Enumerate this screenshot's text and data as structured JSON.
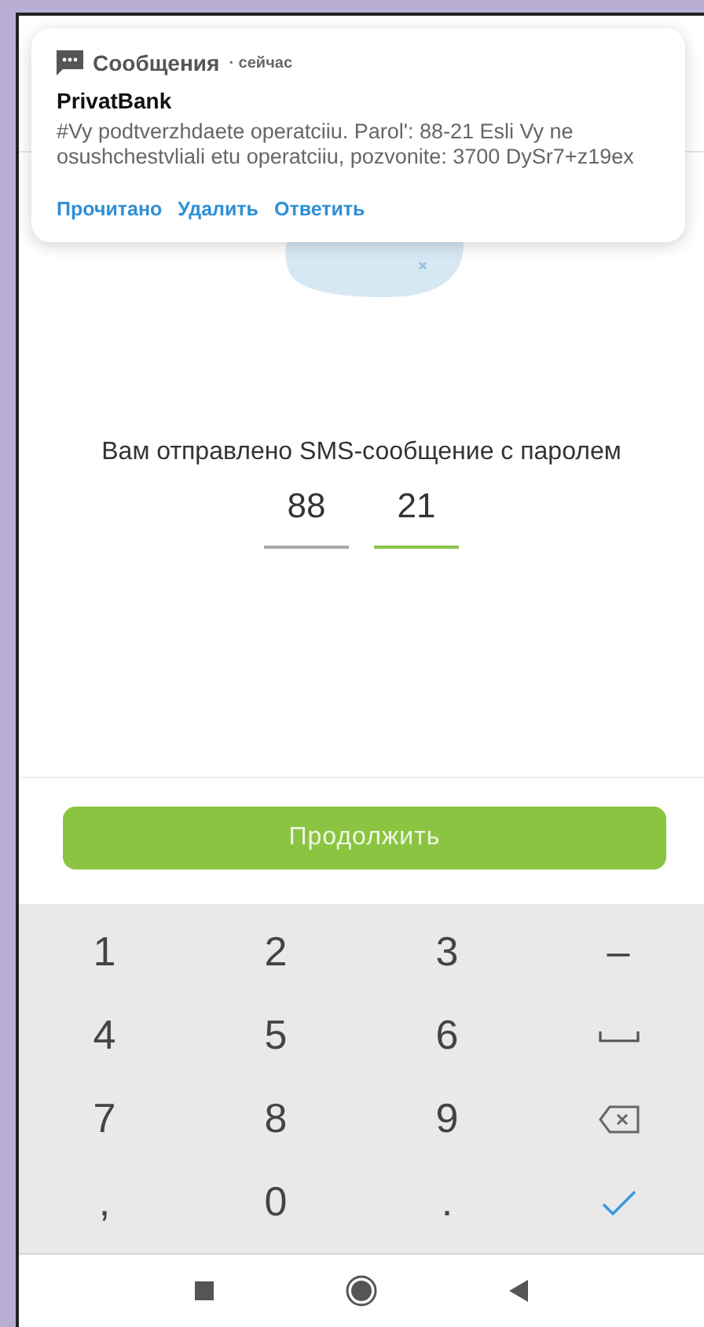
{
  "notification": {
    "app": "Сообщения",
    "time": "· сейчас",
    "sender": "PrivatBank",
    "body": "#Vy podtverzhdaete operatciiu. Parol': 88-21 Esli Vy ne osushchestvliali etu operatciiu, pozvonite: 3700 DySr7+z19ex",
    "actions": [
      "Прочитано",
      "Удалить",
      "Ответить"
    ]
  },
  "message": "Вам отправлено SMS-сообщение с паролем",
  "code_fields": [
    {
      "value": "88",
      "focused": false
    },
    {
      "value": "21",
      "focused": true
    }
  ],
  "continue_button": "Продолжить",
  "keyboard": [
    {
      "kind": "text",
      "label": "1"
    },
    {
      "kind": "text",
      "label": "2"
    },
    {
      "kind": "text",
      "label": "3"
    },
    {
      "kind": "text",
      "label": "–"
    },
    {
      "kind": "text",
      "label": "4"
    },
    {
      "kind": "text",
      "label": "5"
    },
    {
      "kind": "text",
      "label": "6"
    },
    {
      "kind": "space"
    },
    {
      "kind": "text",
      "label": "7"
    },
    {
      "kind": "text",
      "label": "8"
    },
    {
      "kind": "text",
      "label": "9"
    },
    {
      "kind": "backspace"
    },
    {
      "kind": "text",
      "label": ","
    },
    {
      "kind": "text",
      "label": "0"
    },
    {
      "kind": "text",
      "label": "."
    },
    {
      "kind": "enter"
    }
  ]
}
